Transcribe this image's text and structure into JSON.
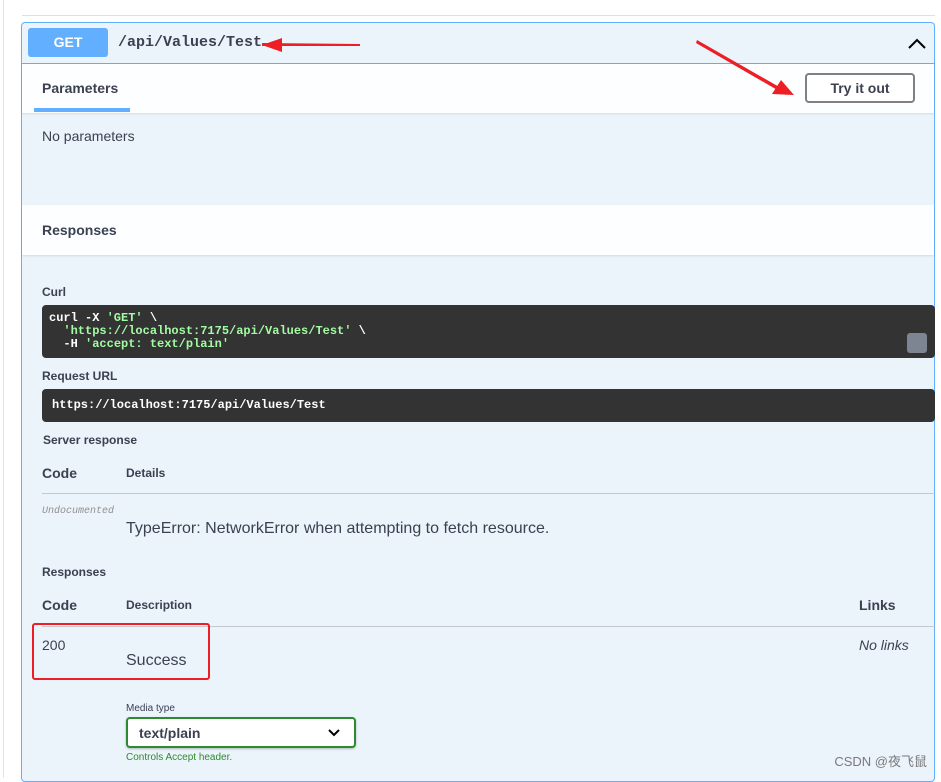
{
  "endpoint": {
    "method": "GET",
    "path": "/api/Values/Test"
  },
  "parameters": {
    "tab_label": "Parameters",
    "try_button": "Try it out",
    "none_text": "No parameters"
  },
  "responses_header": "Responses",
  "curl": {
    "label": "Curl",
    "line1_cmd": "curl -X ",
    "line1_str": "'GET'",
    "line1_end": " \\",
    "line2_str": "'https://localhost:7175/api/Values/Test'",
    "line2_end": " \\",
    "line3_cmd": "  -H ",
    "line3_str": "'accept: text/plain'"
  },
  "request_url": {
    "label": "Request URL",
    "value": "https://localhost:7175/api/Values/Test"
  },
  "server_response": {
    "label": "Server response",
    "col_code": "Code",
    "col_details": "Details",
    "row_code": "Undocumented",
    "row_details": "TypeError: NetworkError when attempting to fetch resource."
  },
  "responses": {
    "label": "Responses",
    "col_code": "Code",
    "col_description": "Description",
    "col_links": "Links",
    "row_code": "200",
    "row_description": "Success",
    "row_links": "No links",
    "media_type_label": "Media type",
    "media_type_value": "text/plain",
    "controls_note": "Controls Accept header."
  },
  "watermark": "CSDN @夜飞鼠",
  "colors": {
    "get_blue": "#61affe",
    "annotation_red": "#ed1f24",
    "media_green": "#2e8a2e"
  }
}
